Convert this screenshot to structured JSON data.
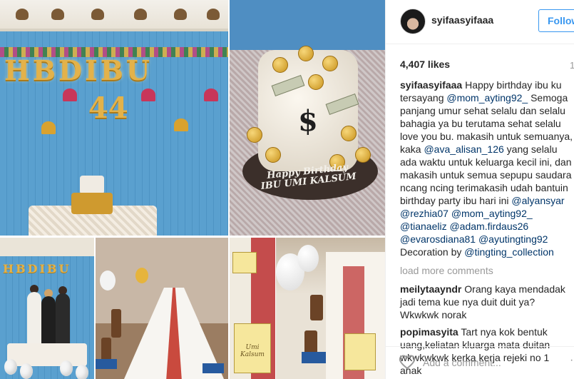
{
  "photos": {
    "wall_letters": [
      "H",
      "B",
      "D",
      "I",
      "B",
      "U"
    ],
    "wall_number": "44",
    "cake_text": [
      "Happy Birthday",
      "IBU UMI KALSUM"
    ],
    "family_letters": [
      "H",
      "B",
      "D",
      "I",
      "B",
      "U"
    ],
    "card_text": "Umi Kalsum"
  },
  "header": {
    "username": "syifaasyifaaa",
    "follow_label": "Follow",
    "accent_color": "#3897f0"
  },
  "meta": {
    "likes": "4,407 likes",
    "time": "1"
  },
  "caption": {
    "user": "syifaasyifaaa",
    "part1": "Happy birthday ibu ku tersayang",
    "mention1": "@mom_ayting92_",
    "part2": "Semoga panjang umur sehat selalu dan selalu bahagia ya bu terutama sehat selalu love you bu. makasih untuk semuanya, kaka",
    "mention2": "@ava_alisan_126",
    "part3": "yang selalu ada waktu untuk keluarga kecil ini, dan makasih untuk semua sepupu saudara ncang ncing terimakasih udah bantuin birthday party ibu hari ini",
    "mentions": [
      "@alyansyar",
      "@rezhia07",
      "@mom_ayting92_",
      "@tianaeliz",
      "@adam.firdaus26",
      "@evarosdiana81",
      "@ayutingting92"
    ],
    "decoration_label": "Decoration by",
    "decoration_mention": "@tingting_collection"
  },
  "load_more": "load more comments",
  "comments": [
    {
      "user": "meilytaayndr",
      "text": "Orang kaya mendadak jadi tema kue nya duit duit ya? Wkwkwk norak"
    },
    {
      "user": "popimasyita",
      "text": "Tart nya kok bentuk uang,keliatan kluarga mata duitan wkwkwkwk kerka kerja rejeki no 1 anak"
    }
  ],
  "footer": {
    "add_comment_placeholder": "Add a comment...",
    "more_icon": "ellipsis-icon"
  }
}
